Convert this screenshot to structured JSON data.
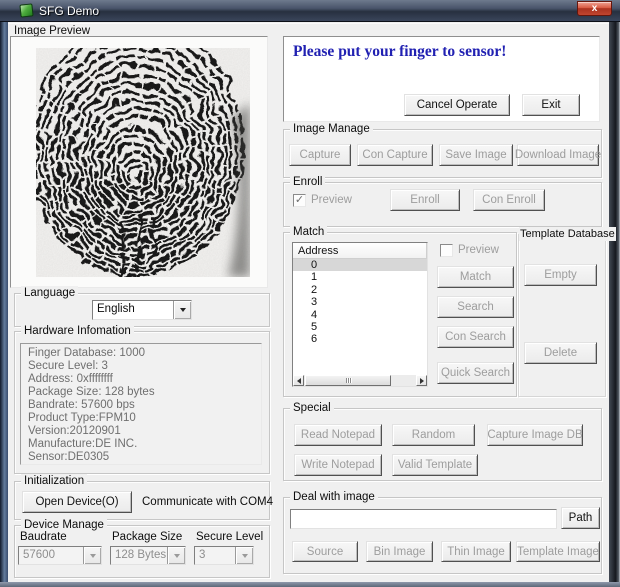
{
  "window": {
    "title": "SFG Demo",
    "close_glyph": "x"
  },
  "left": {
    "image_preview_label": "Image Preview",
    "language": {
      "label": "Language",
      "selected": "English"
    },
    "hardware": {
      "label": "Hardware Infomation",
      "lines": [
        "Finger Database: 1000",
        "Secure Level: 3",
        "Address: 0xffffffff",
        "Package Size: 128 bytes",
        "Bandrate: 57600 bps",
        "Product Type:FPM10",
        "Version:20120901",
        "Manufacture:DE INC.",
        "Sensor:DE0305"
      ]
    },
    "init": {
      "label": "Initialization",
      "open_button": "Open Device(O)",
      "status": "Communicate with COM4"
    },
    "device": {
      "label": "Device Manage",
      "baudrate_label": "Baudrate",
      "baudrate_value": "57600",
      "package_label": "Package Size",
      "package_value": "128 Bytes",
      "secure_label": "Secure Level",
      "secure_value": "3"
    }
  },
  "right": {
    "message": "Please put your finger to sensor!",
    "cancel_button": "Cancel Operate",
    "exit_button": "Exit",
    "image_manage": {
      "label": "Image Manage",
      "buttons": [
        "Capture",
        "Con Capture",
        "Save Image",
        "Download Image"
      ]
    },
    "enroll": {
      "label": "Enroll",
      "preview_label": "Preview",
      "check_glyph": "✓",
      "enroll_button": "Enroll",
      "con_enroll_button": "Con Enroll"
    },
    "match": {
      "label": "Match",
      "header": "Address",
      "rows": [
        "0",
        "1",
        "2",
        "3",
        "4",
        "5",
        "6"
      ],
      "preview_label": "Preview",
      "buttons": [
        "Match",
        "Search",
        "Con Search",
        "Quick Search"
      ]
    },
    "template_db": {
      "label": "Template Database",
      "empty_button": "Empty",
      "delete_button": "Delete"
    },
    "special": {
      "label": "Special",
      "row1": [
        "Read Notepad",
        "Random",
        "Capture Image DB"
      ],
      "row2": [
        "Write Notepad",
        "Valid Template"
      ]
    },
    "deal": {
      "label": "Deal with image",
      "input_value": "",
      "path_button": "Path",
      "buttons": [
        "Source",
        "Bin Image",
        "Thin Image",
        "Template Image"
      ]
    }
  },
  "colors": {
    "message_blue": "#2121b2",
    "close_red": "#c1462f",
    "titlebar": "#3a455b",
    "client_bg": "#f0f0f0"
  }
}
